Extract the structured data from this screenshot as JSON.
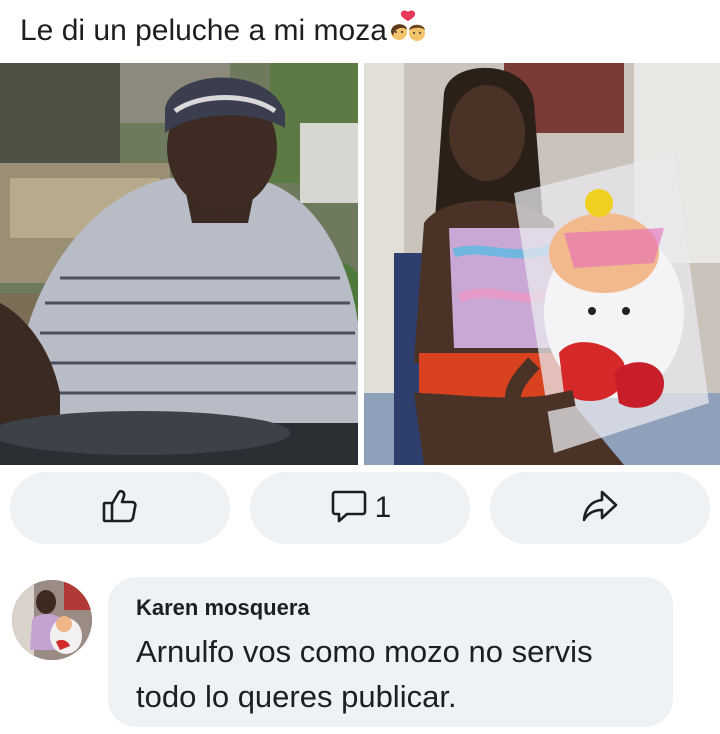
{
  "post": {
    "text": "Le di un peluche a mi moza",
    "emoji": "couple-with-heart-emoji",
    "photos": [
      {
        "name": "man-in-striped-shirt-photo"
      },
      {
        "name": "woman-holding-teddy-bear-photo"
      }
    ]
  },
  "actions": {
    "like_icon": "thumbs-up-icon",
    "comment_icon": "speech-bubble-icon",
    "comment_count": "1",
    "share_icon": "share-arrow-icon"
  },
  "comment": {
    "author": "Karen mosquera",
    "text": "Arnulfo vos como mozo no servis todo lo queres publicar."
  },
  "colors": {
    "button_bg": "#eff2f5",
    "text": "#1c1e21",
    "icon": "#1c1e21"
  }
}
